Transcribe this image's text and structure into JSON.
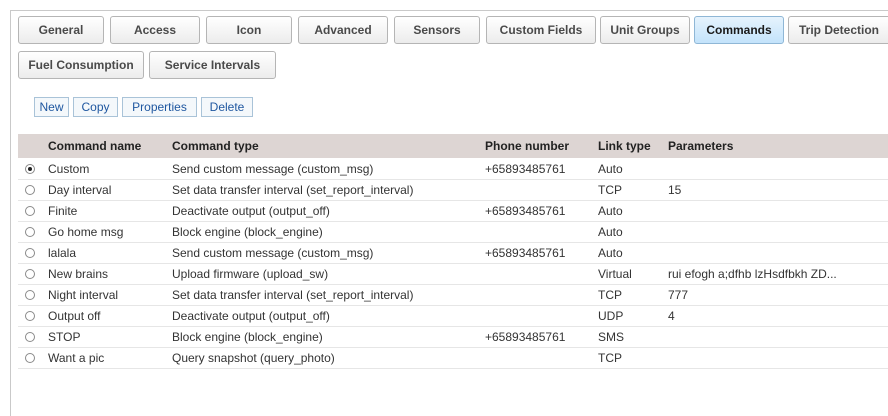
{
  "tabs_row1": [
    "General",
    "Access",
    "Icon",
    "Advanced",
    "Sensors",
    "Custom Fields",
    "Unit Groups",
    "Commands",
    "Trip Detection"
  ],
  "tabs_row2": [
    "Fuel Consumption",
    "Service Intervals"
  ],
  "active_tab": "Commands",
  "toolbar": {
    "new": "New",
    "copy": "Copy",
    "properties": "Properties",
    "delete": "Delete"
  },
  "table": {
    "headers": [
      "Command name",
      "Command type",
      "Phone number",
      "Link type",
      "Parameters"
    ],
    "rows": [
      {
        "name": "Custom",
        "type": "Send custom message (custom_msg)",
        "phone": "+65893485761",
        "link": "Auto",
        "params": "",
        "selected": true
      },
      {
        "name": "Day interval",
        "type": "Set data transfer interval (set_report_interval)",
        "phone": "",
        "link": "TCP",
        "params": "15",
        "selected": false
      },
      {
        "name": "Finite",
        "type": "Deactivate output (output_off)",
        "phone": "+65893485761",
        "link": "Auto",
        "params": "",
        "selected": false
      },
      {
        "name": "Go home msg",
        "type": "Block engine (block_engine)",
        "phone": "",
        "link": "Auto",
        "params": "",
        "selected": false
      },
      {
        "name": "lalala",
        "type": "Send custom message (custom_msg)",
        "phone": "+65893485761",
        "link": "Auto",
        "params": "",
        "selected": false
      },
      {
        "name": "New brains",
        "type": "Upload firmware (upload_sw)",
        "phone": "",
        "link": "Virtual",
        "params": "rui efogh a;dfhb lzHsdfbkh ZD...",
        "selected": false
      },
      {
        "name": "Night interval",
        "type": "Set data transfer interval (set_report_interval)",
        "phone": "",
        "link": "TCP",
        "params": "777",
        "selected": false
      },
      {
        "name": "Output off",
        "type": "Deactivate output (output_off)",
        "phone": "",
        "link": "UDP",
        "params": "4",
        "selected": false
      },
      {
        "name": "STOP",
        "type": "Block engine (block_engine)",
        "phone": "+65893485761",
        "link": "SMS",
        "params": "",
        "selected": false
      },
      {
        "name": "Want a pic",
        "type": "Query snapshot (query_photo)",
        "phone": "",
        "link": "TCP",
        "params": "",
        "selected": false
      }
    ]
  },
  "colors": {
    "active_tab_bg": "#c3e3fb",
    "header_bg": "#ddd5d3",
    "button_text": "#1f57a0"
  }
}
